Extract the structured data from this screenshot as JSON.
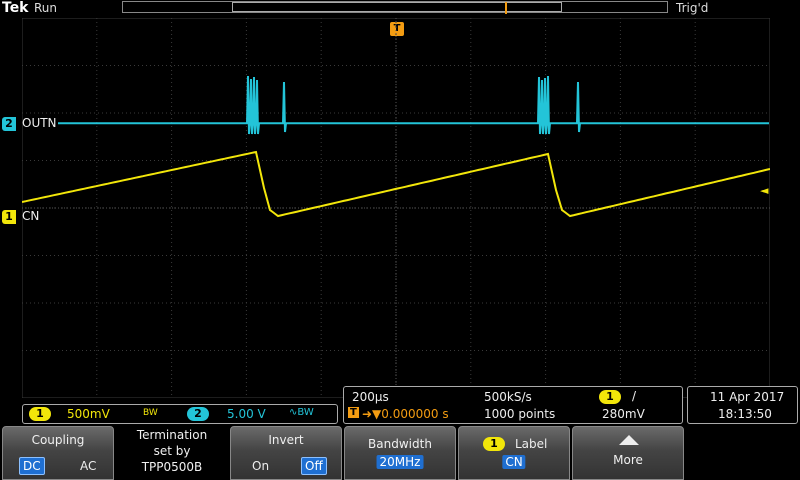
{
  "header": {
    "brand": "Tek",
    "acquisition_state": "Run",
    "trigger_state": "Trig'd"
  },
  "trigger": {
    "position_marker": "T",
    "level_marker": "◄"
  },
  "channels": [
    {
      "number": "2",
      "label": "OUTN",
      "color": "#23c4d8"
    },
    {
      "number": "1",
      "label": "CN",
      "color": "#f2e60a"
    }
  ],
  "vertical_readout": {
    "ch1_number": "1",
    "ch1_scale": "500mV",
    "ch1_bw_icon": "bandwidth-limit-icon",
    "ch1_bw_text": "BW",
    "ch2_number": "2",
    "ch2_scale": "5.00 V",
    "ch2_coupling_text": "∿BW"
  },
  "horizontal_readout": {
    "time_per_div": "200µs",
    "trigger_delay_prefix": "T",
    "trigger_delay": "➜▼0.000000 s",
    "sample_rate": "500kS/s",
    "record_length": "1000 points",
    "trigger_source": "1",
    "trigger_slope": "/",
    "trigger_level": "280mV"
  },
  "datetime": {
    "date": "11 Apr  2017",
    "time": "18:13:50"
  },
  "softkeys": {
    "coupling": {
      "title": "Coupling",
      "options": [
        "DC",
        "AC"
      ],
      "selected": "DC"
    },
    "termination": {
      "line1": "Termination",
      "line2": "set by",
      "line3": "TPP0500B"
    },
    "invert": {
      "title": "Invert",
      "options": [
        "On",
        "Off"
      ],
      "selected": "Off"
    },
    "bandwidth": {
      "title": "Bandwidth",
      "value": "20MHz"
    },
    "label": {
      "channel": "1",
      "title": "Label",
      "value": "CN"
    },
    "more": {
      "title": "More",
      "icon": "chevron-up-icon"
    }
  },
  "colors": {
    "ch1": "#f2e60a",
    "ch2": "#23c4d8",
    "trigger": "#f39c12",
    "selected": "#1f6fd1"
  }
}
